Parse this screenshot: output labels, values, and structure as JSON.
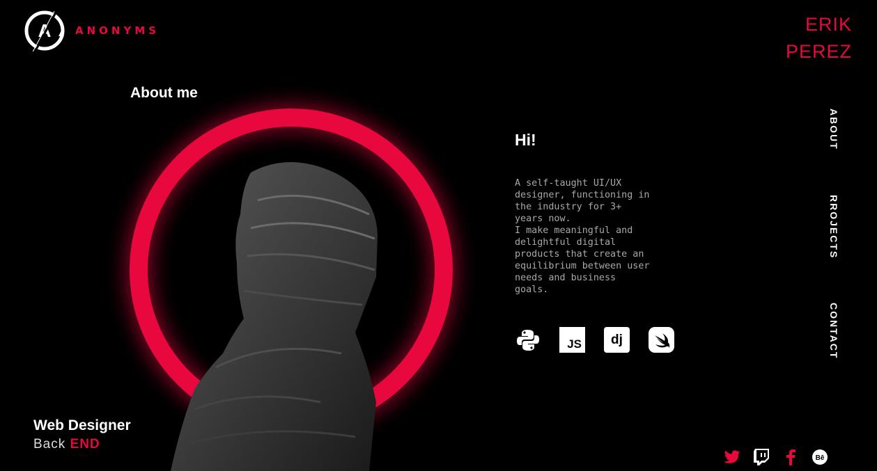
{
  "brand": {
    "name": "ANONYMS",
    "logo_letter": "A"
  },
  "owner": {
    "first": "ERIK",
    "last": "PEREZ"
  },
  "about": {
    "heading": "About me",
    "greeting": "Hi!",
    "bio_lines": [
      "A self-taught UI/UX designer, functioning in the industry for 3+ years now.",
      "I make meaningful and delightful digital products that create an equilibrium between user needs and business goals."
    ]
  },
  "tech": {
    "js_label": "JS",
    "django_label": "dj"
  },
  "nav": {
    "items": [
      {
        "label": "ABOUT",
        "active": true
      },
      {
        "label": "RROJECTS",
        "active": false
      },
      {
        "label": "CONTACT",
        "active": false
      }
    ]
  },
  "role": {
    "title": "Web Designer",
    "sub_prefix": "Back",
    "sub_accent": "END"
  },
  "social": {
    "behance_label": "Bē"
  },
  "colors": {
    "accent": "#e8083e",
    "background": "#000000"
  }
}
